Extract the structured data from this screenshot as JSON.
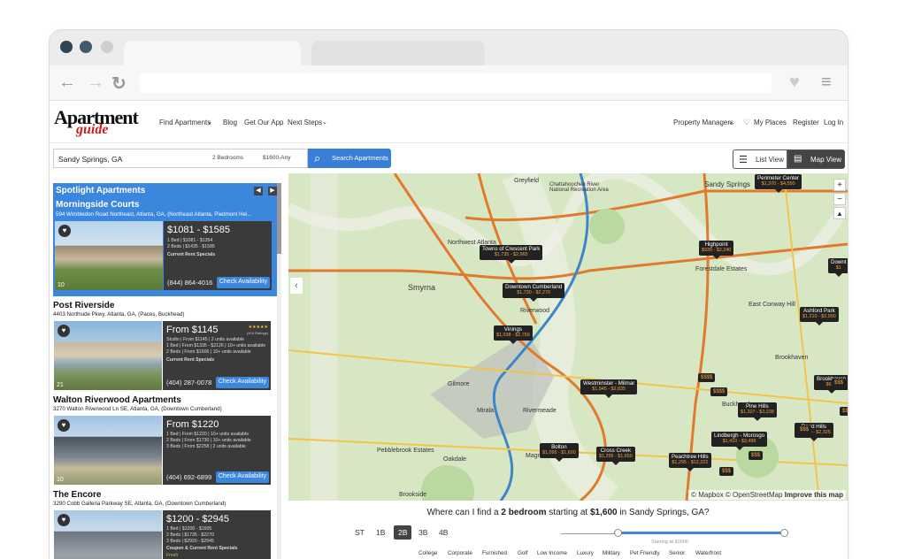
{
  "header": {
    "logo_top": "Apartment",
    "logo_bottom": "guide",
    "nav": {
      "find": "Find Apartments",
      "blog": "Blog",
      "app": "Get Our App",
      "next": "Next Steps"
    },
    "right": {
      "pm": "Property Managers",
      "places": "My Places",
      "register": "Register",
      "login": "Log In"
    }
  },
  "search": {
    "location": "Sandy Springs, GA",
    "bedrooms": "2 Bedrooms",
    "price": "$1600-Any",
    "button": "Search Apartments",
    "list_view": "List View",
    "map_view": "Map View"
  },
  "spotlight": {
    "heading": "Spotlight Apartments",
    "name": "Morningside Courts",
    "address": "594 Wimbledon Road Northeast, Atlanta, GA, (Northeast Atlanta, Piedmont Hei...",
    "price": "$1081 - $1585",
    "d1": "1 Bed | $1081 - $1354",
    "d2": "2 Beds | $1435 - $1585",
    "specials": "Current Rent Specials",
    "phone": "(844) 864-4016",
    "check": "Check Availability",
    "photo_count": "10"
  },
  "listings": [
    {
      "name": "Post Riverside",
      "address": "4403 Northside Pkwy, Atlanta, GA, (Paces, Buckhead)",
      "price": "From $1145",
      "d1": "Studio | From $1145 | 2 units available",
      "d2": "1 Bed | From $1335 - $2126 | 10+ units available",
      "d3": "2 Beds | From $1606 | 10+ units available",
      "specials": "Current Rent Specials",
      "phone": "(404) 287-0078",
      "check": "Check Availability",
      "count": "21",
      "ratings": "(404 Ratings)"
    },
    {
      "name": "Walton Riverwood Apartments",
      "address": "3270 Walton Riverwood Ln SE, Atlanta, GA, (Downtown Cumberland)",
      "price": "From $1220",
      "d1": "1 Bed | From $1220 | 10+ units available",
      "d2": "2 Beds | From $1730 | 10+ units available",
      "d3": "3 Beds | From $2258 | 2 units available",
      "specials": "",
      "phone": "(404) 692-6899",
      "check": "Check Availability",
      "count": "10",
      "ratings": ""
    },
    {
      "name": "The Encore",
      "address": "3290 Cobb Galleria Parkway SE, Atlanta, GA, (Downtown Cumberland)",
      "price": "$1200 - $2945",
      "d1": "1 Bed | $1200 - $1605",
      "d2": "2 Beds | $1735 - $2270",
      "d3": "3 Beds | $2920 - $2945",
      "specials": "Coupon & Current Rent Specials",
      "phone": "",
      "check": "",
      "count": "",
      "ratings": "Fresh"
    }
  ],
  "map": {
    "pins": [
      {
        "name": "Perimeter Center",
        "range": "$1,370 - $4,550"
      },
      {
        "name": "Towns of Crescent Park",
        "range": "$1,735 - $2,965"
      },
      {
        "name": "Highpoint",
        "range": "$939 - $2,240"
      },
      {
        "name": "Downtown Cumberland",
        "range": "$1,730 - $2,270"
      },
      {
        "name": "Vinings",
        "range": "$1,038 - $2,769"
      },
      {
        "name": "Ashford Park",
        "range": "$1,210 - $2,990"
      },
      {
        "name": "Westminster - Milmar",
        "range": "$1,945 - $2,835"
      },
      {
        "name": "Pine Hills",
        "range": "$1,327 - $2,238"
      },
      {
        "name": "Lindbergh - Morosgo",
        "range": "$1,410 - $3,499"
      },
      {
        "name": "Bolton",
        "range": "$1,095 - $1,600"
      },
      {
        "name": "Cross Creek",
        "range": "$1,295 - $1,650"
      },
      {
        "name": "Peachtree Hills",
        "range": "$1,295 - $12,322"
      },
      {
        "name": "Druid Hills",
        "range": "$1,210 - $2,325"
      },
      {
        "name": "Brookhaven",
        "range": "$628"
      },
      {
        "name": "Downt",
        "range": "$1"
      }
    ],
    "dollar_tags": [
      "$$$$",
      "$$$$",
      "$$$",
      "$$$",
      "$$$",
      "$$$",
      "$$$"
    ],
    "labels": [
      "Sandy Springs",
      "Smyrna",
      "Northwest Atlanta",
      "Forestdale Estates",
      "East Conway Hill",
      "Greyfield",
      "Chattahoochee River National Recreation Area",
      "Gilmore",
      "Mirala",
      "Rivermeade",
      "Magnolia",
      "Oakdale",
      "Brookside",
      "Pebblebrook Estates",
      "Brookhaven",
      "Buckhead",
      "Riverwood"
    ],
    "attribution": "© Mapbox © OpenStreetMap",
    "improve": "Improve this map"
  },
  "bottom": {
    "q1": "Where can I find a ",
    "q2": "2 bedroom",
    "q3": " starting at ",
    "q4": "$1,600",
    "q5": " in Sandy Springs, GA?",
    "beds": [
      "ST",
      "1B",
      "2B",
      "3B",
      "4B"
    ],
    "slider_label": "Starting at $1600",
    "amenities": [
      "College",
      "Corporate",
      "Furnished",
      "Golf",
      "Low Income",
      "Luxury",
      "Military",
      "Pet Friendly",
      "Senior",
      "Waterfront"
    ]
  },
  "colors": {
    "accent": "#3a87dd",
    "logo_red": "#c81e1e",
    "pin": "#222222",
    "pin_range": "#f6a341"
  },
  "slider": {
    "min": 0,
    "max": 1,
    "start_fraction": 0.0,
    "end_fraction": 1.0
  }
}
